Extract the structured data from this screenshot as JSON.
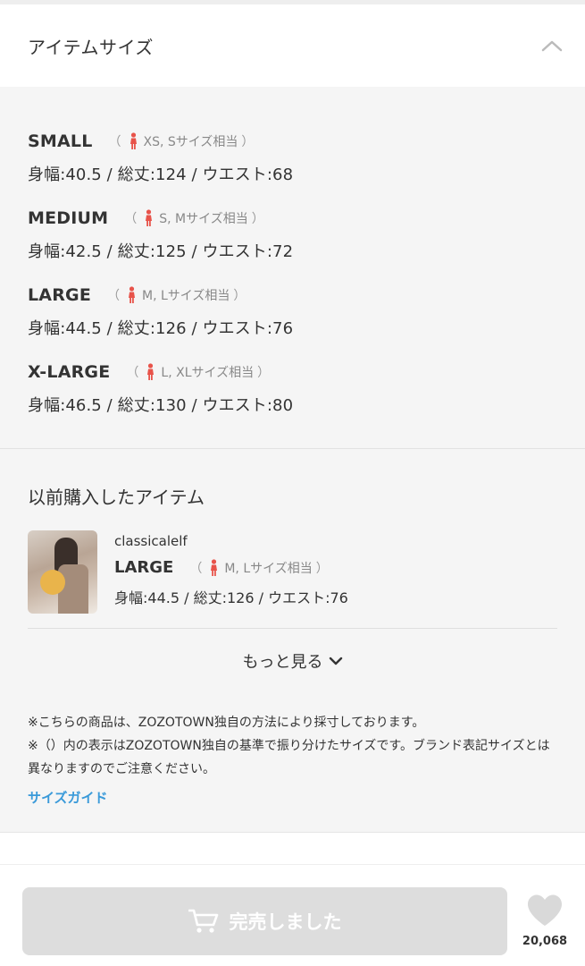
{
  "header": {
    "title": "アイテムサイズ"
  },
  "sizes": [
    {
      "name": "SMALL",
      "equiv": "XS, Sサイズ相当",
      "measures": "身幅:40.5 / 総丈:124 / ウエスト:68"
    },
    {
      "name": "MEDIUM",
      "equiv": "S, Mサイズ相当",
      "measures": "身幅:42.5 / 総丈:125 / ウエスト:72"
    },
    {
      "name": "LARGE",
      "equiv": "M, Lサイズ相当",
      "measures": "身幅:44.5 / 総丈:126 / ウエスト:76"
    },
    {
      "name": "X-LARGE",
      "equiv": "L, XLサイズ相当",
      "measures": "身幅:46.5 / 総丈:130 / ウエスト:80"
    }
  ],
  "previous": {
    "title": "以前購入したアイテム",
    "item": {
      "brand": "classicalelf",
      "size": "LARGE",
      "equiv": "M, Lサイズ相当",
      "measures": "身幅:44.5 / 総丈:126 / ウエスト:76"
    },
    "more_label": "もっと見る"
  },
  "notes": {
    "line1": "※こちらの商品は、ZOZOTOWN独自の方法により採寸しております。",
    "line2": "※（）内の表示はZOZOTOWN独自の基準で振り分けたサイズです。ブランド表記サイズとは異なりますのでご注意ください。",
    "guide_link": "サイズガイド"
  },
  "bottom": {
    "button_label": "完売しました",
    "fav_count": "20,068"
  },
  "colors": {
    "accent_link": "#3a9ad9",
    "person_icon": "#e8534a",
    "disabled_button": "#dddddd"
  }
}
